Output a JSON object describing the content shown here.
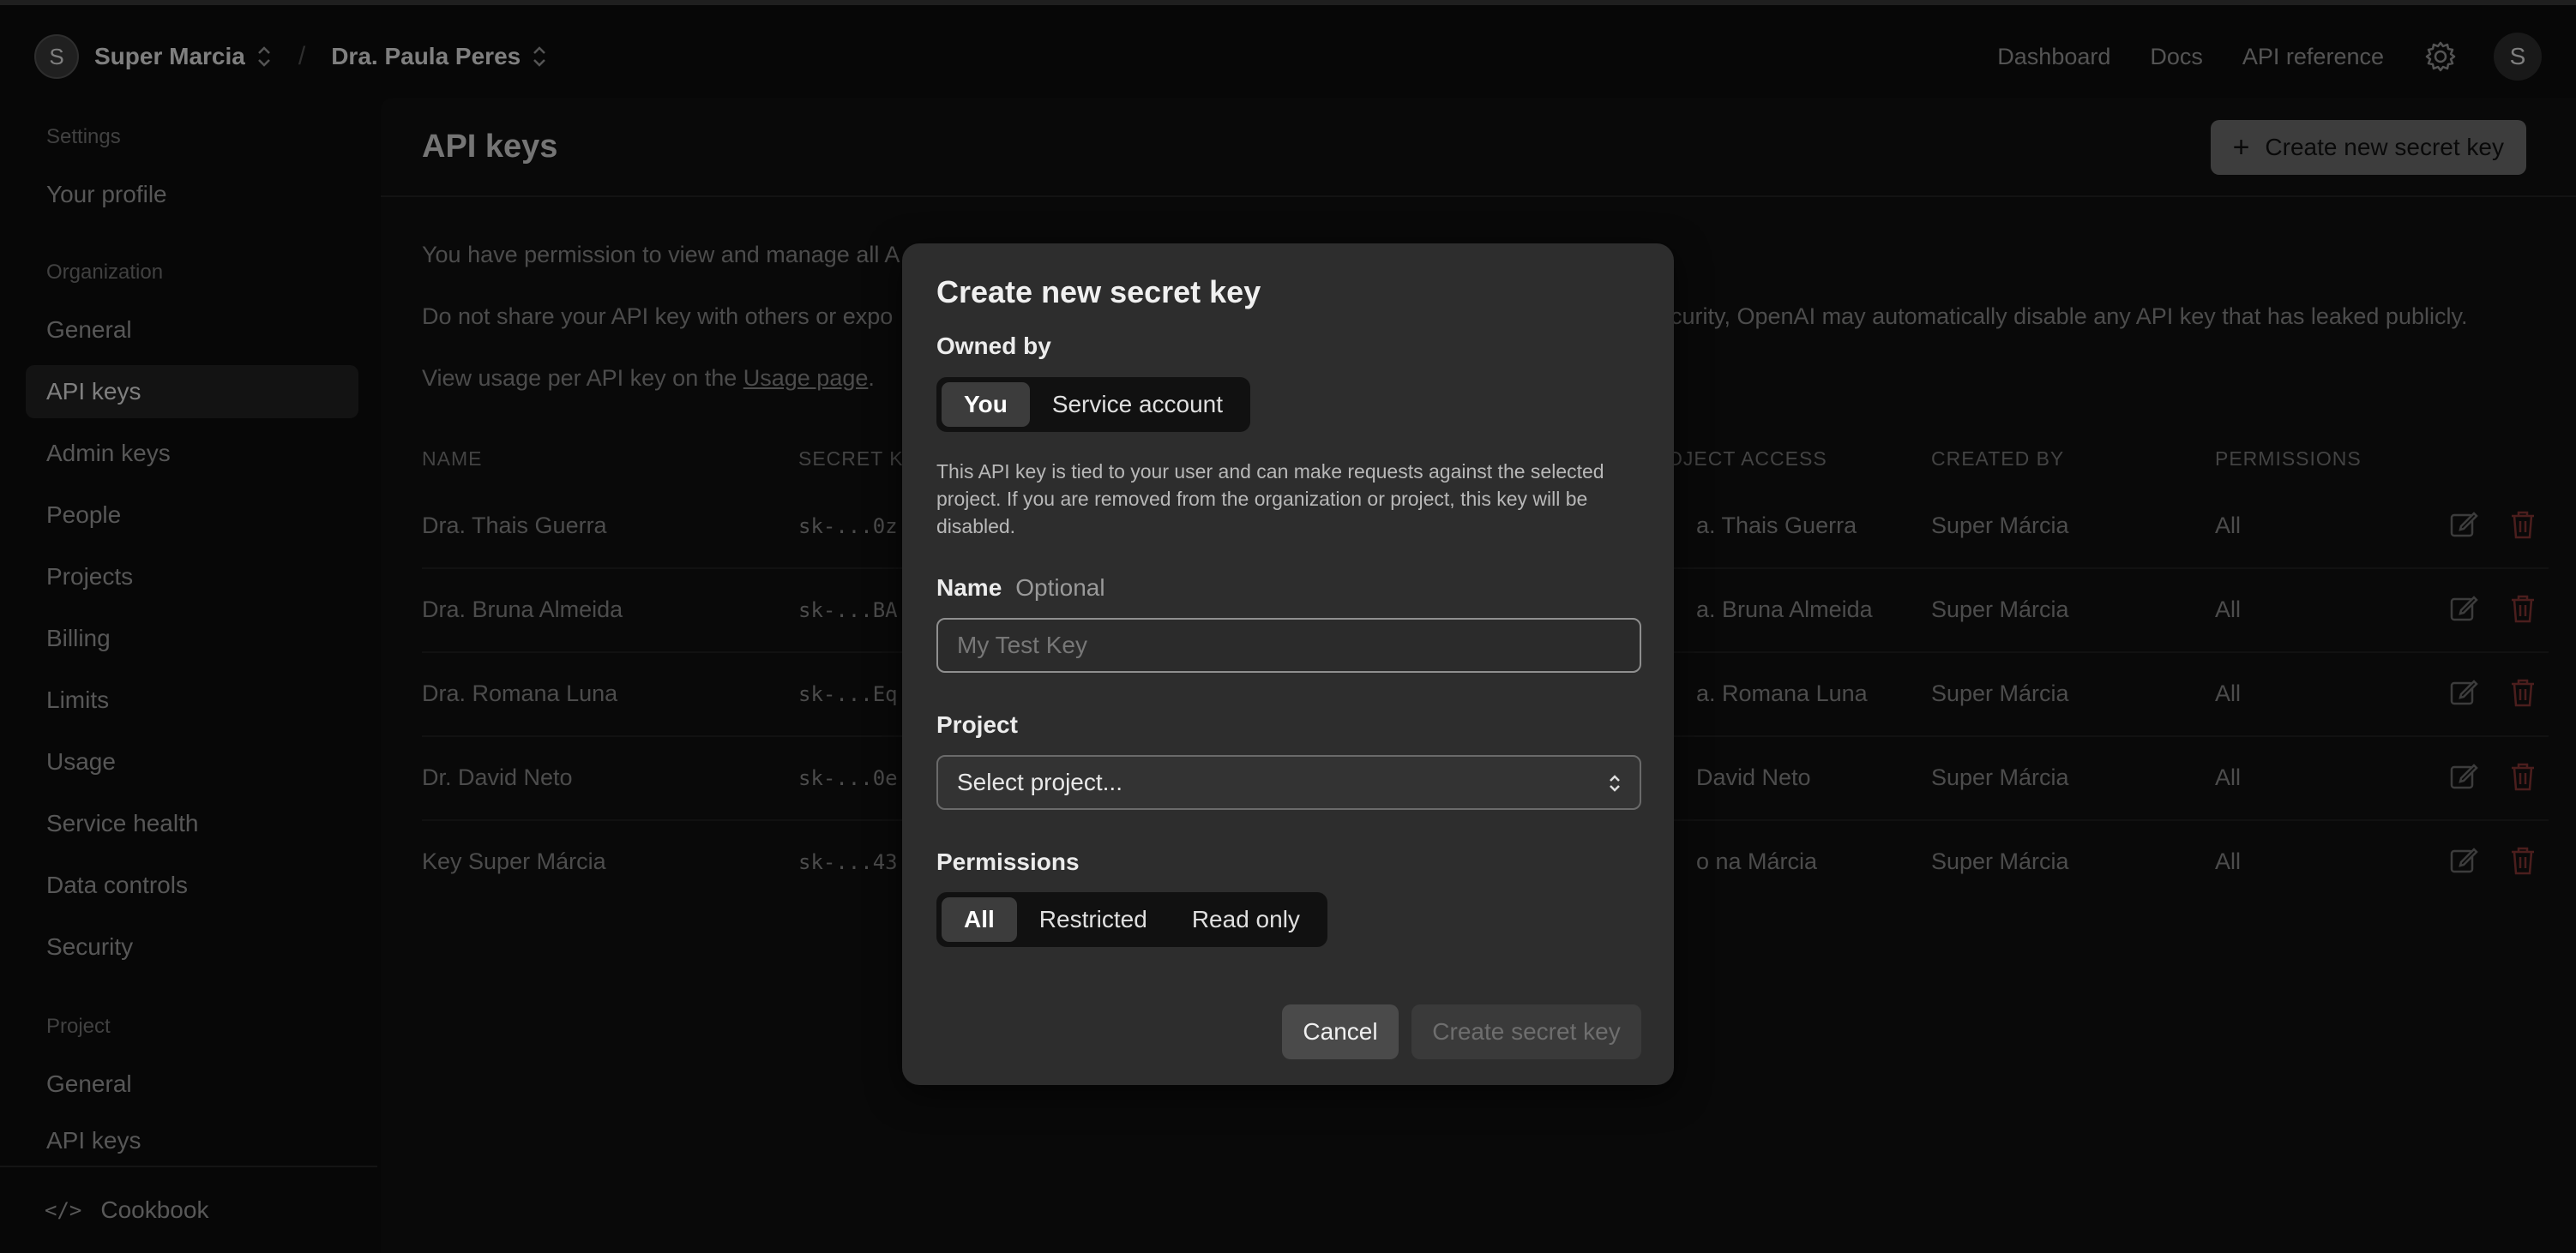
{
  "topbar": {
    "org_avatar": "S",
    "org_name": "Super Marcia",
    "separator": "/",
    "project_name": "Dra. Paula Peres",
    "links": [
      "Dashboard",
      "Docs",
      "API reference"
    ],
    "user_avatar": "S"
  },
  "sidebar": {
    "settings_group": "Settings",
    "your_profile": "Your profile",
    "org_group": "Organization",
    "org_items": [
      "General",
      "API keys",
      "Admin keys",
      "People",
      "Projects",
      "Billing",
      "Limits",
      "Usage",
      "Service health",
      "Data controls",
      "Security"
    ],
    "project_group": "Project",
    "project_items": [
      "General",
      "API keys"
    ],
    "footer": "Cookbook",
    "footer_icon": "</>"
  },
  "main": {
    "title": "API keys",
    "create_button": "Create new secret key",
    "para1": "You have permission to view and manage all A",
    "para2_left": "Do not share your API key with others or expo",
    "para2_right": "curity, OpenAI may automatically disable any API key that has leaked publicly.",
    "para3_prefix": "View usage per API key on the ",
    "para3_link": "Usage page",
    "para3_suffix": ".",
    "table_headers": {
      "name": "NAME",
      "secret": "SECRET K",
      "project_access": "OJECT ACCESS",
      "created_by": "CREATED BY",
      "permissions": "PERMISSIONS"
    },
    "rows": [
      {
        "name": "Dra. Thais Guerra",
        "secret": "sk-...0z",
        "project": "a. Thais Guerra",
        "created_by": "Super Márcia",
        "permissions": "All"
      },
      {
        "name": "Dra. Bruna Almeida",
        "secret": "sk-...BA",
        "project": "a. Bruna Almeida",
        "created_by": "Super Márcia",
        "permissions": "All"
      },
      {
        "name": "Dra. Romana Luna",
        "secret": "sk-...Eq",
        "project": "a. Romana Luna",
        "created_by": "Super Márcia",
        "permissions": "All"
      },
      {
        "name": "Dr. David Neto",
        "secret": "sk-...0e",
        "project": " David Neto",
        "created_by": "Super Márcia",
        "permissions": "All"
      },
      {
        "name": "Key Super Márcia",
        "secret": "sk-...43",
        "project": "o na Márcia",
        "created_by": "Super Márcia",
        "permissions": "All"
      }
    ]
  },
  "modal": {
    "title": "Create new secret key",
    "owned_by_label": "Owned by",
    "owned_by_options": [
      "You",
      "Service account"
    ],
    "owned_by_selected": "You",
    "description": "This API key is tied to your user and can make requests against the selected project. If you are removed from the organization or project, this key will be disabled.",
    "name_label": "Name",
    "name_optional": "Optional",
    "name_placeholder": "My Test Key",
    "name_value": "",
    "project_label": "Project",
    "project_value": "Select project...",
    "permissions_label": "Permissions",
    "permissions_options": [
      "All",
      "Restricted",
      "Read only"
    ],
    "permissions_selected": "All",
    "cancel": "Cancel",
    "submit": "Create secret key"
  },
  "colors": {
    "delete_icon": "#d9534f",
    "background": "#0d0d0d",
    "modal": "#2d2d2d"
  }
}
